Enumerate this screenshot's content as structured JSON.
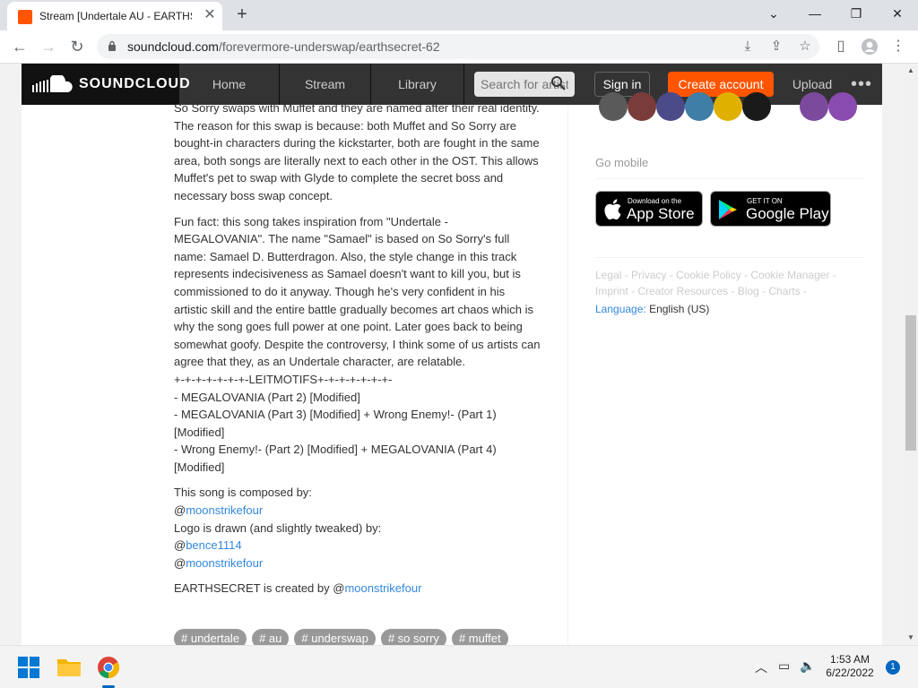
{
  "browser": {
    "tab_title": "Stream [Undertale AU - EARTHSECRET] ...",
    "url_domain": "soundcloud.com",
    "url_path": "/forevermore-underswap/earthsecret-62"
  },
  "header": {
    "logo_text": "SOUNDCLOUD",
    "nav": [
      "Home",
      "Stream",
      "Library"
    ],
    "search_placeholder": "Search for artists",
    "sign_in": "Sign in",
    "create_account": "Create account",
    "upload": "Upload",
    "more": "•••"
  },
  "description": {
    "para1": "So Sorry swaps with Muffet and they are named after their real identity. The reason for this swap is because: both Muffet and So Sorry are bought-in characters during the kickstarter, both are fought in the same area, both songs are literally next to each other in the OST. This allows Muffet's pet to swap with Glyde to complete the secret boss and necessary boss swap concept.",
    "para2": "Fun fact: this song takes inspiration from \"Undertale - MEGALOVANIA\". The name \"Samael\" is based on So Sorry's full name: Samael D. Butterdragon. Also, the style change in this track represents indecisiveness as Samael doesn't want to kill you, but is commissioned to do it anyway. Though he's very confident in his artistic skill and the entire battle gradually becomes art chaos which is why the song goes full power at one point. Later goes back to being somewhat goofy. Despite the controversy, I think some of us artists can agree that they, as an Undertale character, are relatable.",
    "leitmotifs_header": "+-+-+-+-+-+-+-LEITMOTIFS+-+-+-+-+-+-+-",
    "leitmotif1": "- MEGALOVANIA (Part 2) [Modified]",
    "leitmotif2": "- MEGALOVANIA (Part 3) [Modified] + Wrong Enemy!- (Part 1) [Modified]",
    "leitmotif3": "- Wrong Enemy!- (Part 2) [Modified] + MEGALOVANIA (Part 4) [Modified]",
    "composed_by": "This song is composed by:",
    "at": "@",
    "composer": "moonstrikefour",
    "logo_by": "Logo is drawn (and slightly tweaked) by:",
    "logo_artist1": "bence1114",
    "logo_artist2": "moonstrikefour",
    "created_by": "EARTHSECRET is created by @",
    "creator": "moonstrikefour"
  },
  "tags": [
    "# undertale",
    "# au",
    "# underswap",
    "# so sorry",
    "# muffet"
  ],
  "sidebar": {
    "go_mobile": "Go mobile",
    "app_store_small": "Download on the",
    "app_store_big": "App Store",
    "google_play_small": "GET IT ON",
    "google_play_big": "Google Play",
    "footer_line1": "Legal - Privacy - Cookie Policy - Cookie Manager -",
    "footer_line2": "Imprint - Creator Resources - Blog - Charts -",
    "language_label": "Language:",
    "language_value": "English (US)"
  },
  "taskbar": {
    "time": "1:53 AM",
    "date": "6/22/2022",
    "notifications": "1"
  }
}
